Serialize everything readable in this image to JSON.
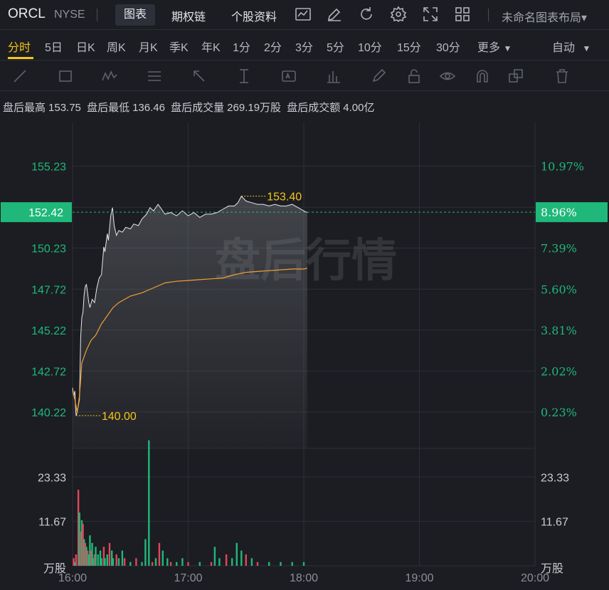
{
  "header": {
    "ticker": "ORCL",
    "exchange": "NYSE",
    "tabs": [
      {
        "label": "图表",
        "active": true
      },
      {
        "label": "期权链",
        "active": false
      },
      {
        "label": "个股资料",
        "active": false
      }
    ],
    "toolbar_icons": [
      "chart-type-icon",
      "draw-pencil-icon",
      "refresh-icon",
      "settings-gear-icon",
      "fullscreen-icon",
      "grid-layout-icon"
    ],
    "layout_menu": "未命名图表布局"
  },
  "periods": {
    "items": [
      "分时",
      "5日",
      "日K",
      "周K",
      "月K",
      "季K",
      "年K",
      "1分",
      "2分",
      "3分",
      "5分",
      "10分",
      "15分",
      "30分",
      "更多"
    ],
    "active": "分时",
    "auto": "自动",
    "accent": "#f5c518"
  },
  "drawing_tools": [
    "line-tool-icon",
    "rectangle-tool-icon",
    "wave-tool-icon",
    "fib-tool-icon",
    "arrow-tool-icon",
    "measure-tool-icon",
    "text-tool-icon",
    "bar-tool-icon",
    "brush-icon",
    "lock-icon",
    "eye-icon",
    "magnet-icon",
    "clone-icon",
    "trash-icon"
  ],
  "stats": {
    "high_label": "盘后最高",
    "high_value": "153.75",
    "low_label": "盘后最低",
    "low_value": "136.46",
    "vol_label": "盘后成交量",
    "vol_value": "269.19万股",
    "amt_label": "盘后成交额",
    "amt_value": "4.00亿"
  },
  "chart_data": {
    "type": "line",
    "watermark": "盘后行情",
    "colors": {
      "price": "#e8e8ec",
      "avg": "#f0a030",
      "up": "#1fb87a",
      "down": "#e0475a",
      "label": "#f5c518",
      "grid": "#2c2f36"
    },
    "x_ticks": [
      "16:00",
      "17:00",
      "18:00",
      "19:00",
      "20:00"
    ],
    "x_range_hours": [
      16,
      20
    ],
    "ylim": [
      138.0,
      157.9
    ],
    "y_ticks_left": [
      "155.23",
      "152.72",
      "150.23",
      "147.72",
      "145.22",
      "142.72",
      "140.22"
    ],
    "y_tick_values": [
      155.23,
      152.72,
      150.23,
      147.72,
      145.22,
      142.72,
      140.22
    ],
    "y_ticks_right": [
      "10.97%",
      "8.96%",
      "7.39%",
      "5.60%",
      "3.81%",
      "2.02%",
      "0.23%"
    ],
    "current_price": "152.42",
    "current_price_value": 152.42,
    "current_pct": "8.96%",
    "max_label": "153.40",
    "max_value": 153.4,
    "max_time": 17.46,
    "min_label": "140.00",
    "min_value": 140.0,
    "min_time": 16.03,
    "series": [
      {
        "values": [
          [
            16.0,
            141.7
          ],
          [
            16.01,
            141.2
          ],
          [
            16.02,
            141.5
          ],
          [
            16.025,
            140.6
          ],
          [
            16.03,
            140.0
          ],
          [
            16.04,
            140.2
          ],
          [
            16.06,
            141.0
          ],
          [
            16.07,
            144.8
          ],
          [
            16.08,
            146.0
          ],
          [
            16.09,
            146.3
          ],
          [
            16.1,
            147.4
          ],
          [
            16.11,
            147.9
          ],
          [
            16.12,
            148.0
          ],
          [
            16.13,
            147.5
          ],
          [
            16.14,
            146.9
          ],
          [
            16.15,
            146.6
          ],
          [
            16.17,
            147.1
          ],
          [
            16.19,
            146.9
          ],
          [
            16.21,
            147.8
          ],
          [
            16.23,
            148.4
          ],
          [
            16.25,
            148.6
          ],
          [
            16.27,
            150.3
          ],
          [
            16.28,
            150.0
          ],
          [
            16.3,
            151.1
          ],
          [
            16.31,
            150.7
          ],
          [
            16.33,
            152.2
          ],
          [
            16.345,
            152.7
          ],
          [
            16.36,
            151.6
          ],
          [
            16.38,
            151.0
          ],
          [
            16.4,
            151.3
          ],
          [
            16.43,
            151.2
          ],
          [
            16.46,
            151.5
          ],
          [
            16.5,
            151.4
          ],
          [
            16.53,
            151.7
          ],
          [
            16.57,
            151.6
          ],
          [
            16.6,
            152.0
          ],
          [
            16.64,
            152.3
          ],
          [
            16.67,
            152.7
          ],
          [
            16.7,
            152.5
          ],
          [
            16.74,
            152.9
          ],
          [
            16.77,
            152.6
          ],
          [
            16.8,
            152.3
          ],
          [
            16.85,
            152.4
          ],
          [
            16.9,
            152.2
          ],
          [
            16.95,
            152.5
          ],
          [
            17.0,
            152.2
          ],
          [
            17.05,
            152.4
          ],
          [
            17.1,
            152.1
          ],
          [
            17.15,
            152.3
          ],
          [
            17.2,
            152.3
          ],
          [
            17.25,
            152.4
          ],
          [
            17.3,
            152.6
          ],
          [
            17.35,
            152.8
          ],
          [
            17.4,
            152.8
          ],
          [
            17.43,
            153.0
          ],
          [
            17.46,
            153.4
          ],
          [
            17.5,
            153.1
          ],
          [
            17.55,
            153.0
          ],
          [
            17.6,
            152.9
          ],
          [
            17.65,
            152.9
          ],
          [
            17.7,
            152.8
          ],
          [
            17.75,
            152.9
          ],
          [
            17.8,
            152.8
          ],
          [
            17.85,
            152.8
          ],
          [
            17.9,
            152.9
          ],
          [
            17.95,
            152.7
          ],
          [
            18.0,
            152.5
          ],
          [
            18.03,
            152.4
          ]
        ]
      },
      {
        "values": [
          [
            16.0,
            141.5
          ],
          [
            16.02,
            141.0
          ],
          [
            16.04,
            140.2
          ],
          [
            16.06,
            141.2
          ],
          [
            16.08,
            143.2
          ],
          [
            16.12,
            144.0
          ],
          [
            16.16,
            144.6
          ],
          [
            16.2,
            144.9
          ],
          [
            16.25,
            145.6
          ],
          [
            16.3,
            146.1
          ],
          [
            16.35,
            146.6
          ],
          [
            16.4,
            146.9
          ],
          [
            16.45,
            147.1
          ],
          [
            16.5,
            147.3
          ],
          [
            16.6,
            147.5
          ],
          [
            16.7,
            147.8
          ],
          [
            16.8,
            148.1
          ],
          [
            16.9,
            148.2
          ],
          [
            17.0,
            148.25
          ],
          [
            17.1,
            148.3
          ],
          [
            17.2,
            148.35
          ],
          [
            17.3,
            148.4
          ],
          [
            17.4,
            148.6
          ],
          [
            17.5,
            148.75
          ],
          [
            17.6,
            148.8
          ],
          [
            17.7,
            148.85
          ],
          [
            17.8,
            148.9
          ],
          [
            17.9,
            148.95
          ],
          [
            18.0,
            148.95
          ],
          [
            18.03,
            149.0
          ]
        ]
      }
    ],
    "volume": {
      "ylim": [
        0,
        29
      ],
      "y_ticks_left": [
        "23.33",
        "11.67"
      ],
      "y_tick_values": [
        23.33,
        11.67
      ],
      "y_ticks_right": [
        "23.33",
        "11.67"
      ],
      "unit": "万股",
      "bars": [
        [
          16.01,
          2,
          "down"
        ],
        [
          16.02,
          1,
          "up"
        ],
        [
          16.03,
          3,
          "down"
        ],
        [
          16.05,
          20,
          "down"
        ],
        [
          16.06,
          14,
          "up"
        ],
        [
          16.07,
          9,
          "down"
        ],
        [
          16.08,
          12,
          "up"
        ],
        [
          16.09,
          11,
          "down"
        ],
        [
          16.1,
          7,
          "up"
        ],
        [
          16.11,
          6,
          "down"
        ],
        [
          16.12,
          5,
          "up"
        ],
        [
          16.13,
          4,
          "down"
        ],
        [
          16.14,
          3,
          "up"
        ],
        [
          16.15,
          8,
          "up"
        ],
        [
          16.16,
          4,
          "down"
        ],
        [
          16.17,
          6,
          "up"
        ],
        [
          16.18,
          2,
          "up"
        ],
        [
          16.19,
          3,
          "down"
        ],
        [
          16.2,
          5,
          "up"
        ],
        [
          16.22,
          3,
          "up"
        ],
        [
          16.24,
          4,
          "up"
        ],
        [
          16.25,
          2,
          "up"
        ],
        [
          16.27,
          5,
          "down"
        ],
        [
          16.28,
          2,
          "up"
        ],
        [
          16.3,
          3,
          "up"
        ],
        [
          16.32,
          6,
          "down"
        ],
        [
          16.34,
          4,
          "up"
        ],
        [
          16.35,
          2,
          "up"
        ],
        [
          16.38,
          3,
          "down"
        ],
        [
          16.4,
          2,
          "up"
        ],
        [
          16.43,
          4,
          "up"
        ],
        [
          16.45,
          2,
          "down"
        ],
        [
          16.5,
          1,
          "up"
        ],
        [
          16.55,
          2,
          "down"
        ],
        [
          16.6,
          1,
          "up"
        ],
        [
          16.63,
          7,
          "up"
        ],
        [
          16.66,
          33,
          "up"
        ],
        [
          16.69,
          1,
          "down"
        ],
        [
          16.72,
          2,
          "up"
        ],
        [
          16.75,
          6,
          "down"
        ],
        [
          16.78,
          4,
          "up"
        ],
        [
          16.82,
          2,
          "up"
        ],
        [
          16.85,
          1,
          "down"
        ],
        [
          16.9,
          1,
          "up"
        ],
        [
          16.95,
          2,
          "up"
        ],
        [
          17.0,
          1,
          "down"
        ],
        [
          17.1,
          1,
          "up"
        ],
        [
          17.2,
          1,
          "down"
        ],
        [
          17.23,
          5,
          "up"
        ],
        [
          17.27,
          2,
          "up"
        ],
        [
          17.33,
          3,
          "down"
        ],
        [
          17.38,
          2,
          "up"
        ],
        [
          17.42,
          6,
          "up"
        ],
        [
          17.46,
          4,
          "up"
        ],
        [
          17.5,
          3,
          "down"
        ],
        [
          17.55,
          2,
          "up"
        ],
        [
          17.6,
          1,
          "down"
        ],
        [
          17.7,
          1,
          "up"
        ],
        [
          17.8,
          1,
          "up"
        ],
        [
          17.9,
          1,
          "up"
        ],
        [
          18.0,
          1,
          "up"
        ]
      ]
    }
  }
}
